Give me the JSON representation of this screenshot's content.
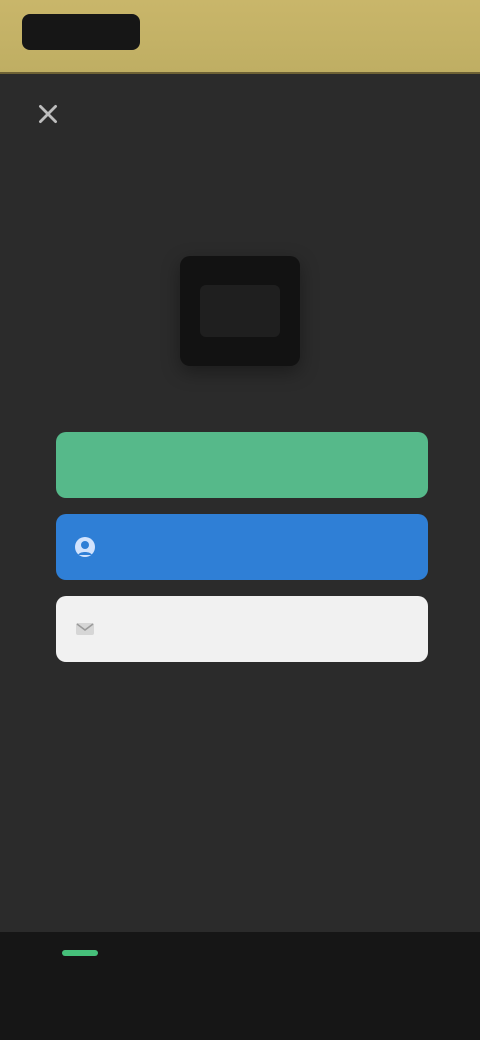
{
  "topbar": {
    "brand_label": "",
    "action_label": ""
  },
  "center": {
    "logo_text": "",
    "caption": ""
  },
  "buttons": {
    "primary_label": "",
    "secondary_label": "",
    "tertiary_label": ""
  },
  "texts": {
    "or_label": "",
    "terms": ""
  },
  "bottom": {
    "banner": "",
    "nav": [
      "",
      "",
      ""
    ]
  },
  "colors": {
    "topbar": "#c9b66a",
    "background": "#2b2b2b",
    "green_button": "#56b98a",
    "blue_button": "#2f7fd6",
    "white_button": "#f1f1f1",
    "bottom_nav": "#161616"
  },
  "icons": {
    "nav": "close-icon",
    "blue_button_icon": "user-icon",
    "white_button_icon": "mail-icon"
  }
}
